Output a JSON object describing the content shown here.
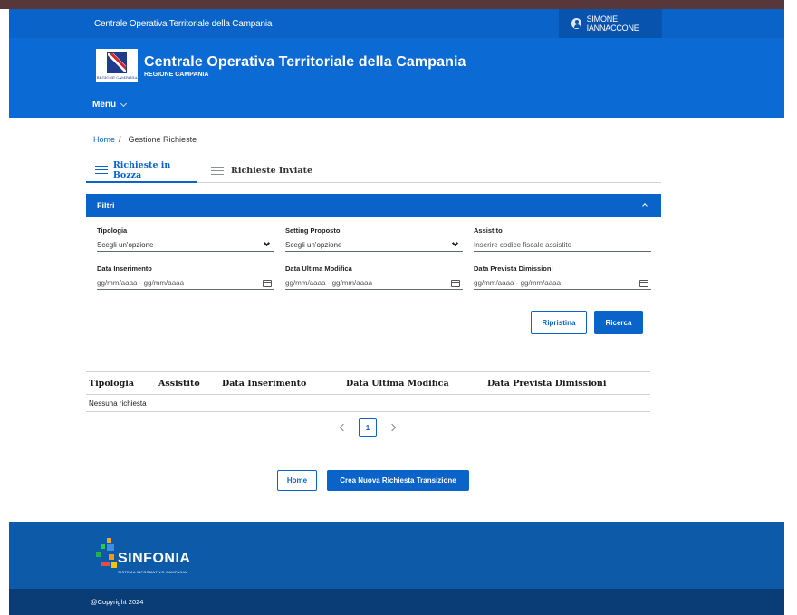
{
  "header": {
    "region_link": "Centrale Operativa Territoriale della Campania",
    "user_name": "SIMONE IANNACCONE",
    "site_title": "Centrale Operativa Territoriale della Campania",
    "site_subtitle": "REGIONE CAMPANIA",
    "logo_text": "REGIONE CAMPANIA",
    "menu_label": "Menu"
  },
  "breadcrumb": {
    "home": "Home",
    "separator": "/",
    "current": "Gestione Richieste"
  },
  "tabs": [
    {
      "label": "Richieste in Bozza",
      "active": true
    },
    {
      "label": "Richieste Inviate",
      "active": false
    }
  ],
  "filters": {
    "title": "Filtri",
    "tipologia": {
      "label": "Tipologia",
      "value": "Scegli un'opzione"
    },
    "setting": {
      "label": "Setting Proposto",
      "value": "Scegli un'opzione"
    },
    "assistito": {
      "label": "Assistito",
      "placeholder": "Inserire codice fiscale assistito"
    },
    "data_inserimento": {
      "label": "Data Inserimento",
      "placeholder": "gg/mm/aaaa - gg/mm/aaaa"
    },
    "data_ultima_modifica": {
      "label": "Data Ultima Modifica",
      "placeholder": "gg/mm/aaaa - gg/mm/aaaa"
    },
    "data_prevista_dimissioni": {
      "label": "Data Prevista Dimissioni",
      "placeholder": "gg/mm/aaaa - gg/mm/aaaa"
    },
    "reset_label": "Ripristina",
    "search_label": "Ricerca"
  },
  "table": {
    "columns": [
      "Tipologia",
      "Assistito",
      "Data Inserimento",
      "Data Ultima Modifica",
      "Data Prevista Dimissioni"
    ],
    "empty_message": "Nessuna richiesta"
  },
  "pagination": {
    "current_page": "1"
  },
  "actions": {
    "home_label": "Home",
    "create_label": "Crea Nuova Richiesta Transizione"
  },
  "footer": {
    "brand": "SINFONIA",
    "brand_sub": "SISTEMA INFORMATIVO CAMPANIA",
    "copyright": "@Copyright 2024"
  },
  "colors": {
    "primary": "#0a63c9",
    "header_slim": "#0a63c9",
    "footer": "#0c5aa8",
    "footer_bottom": "#0a3c75"
  }
}
